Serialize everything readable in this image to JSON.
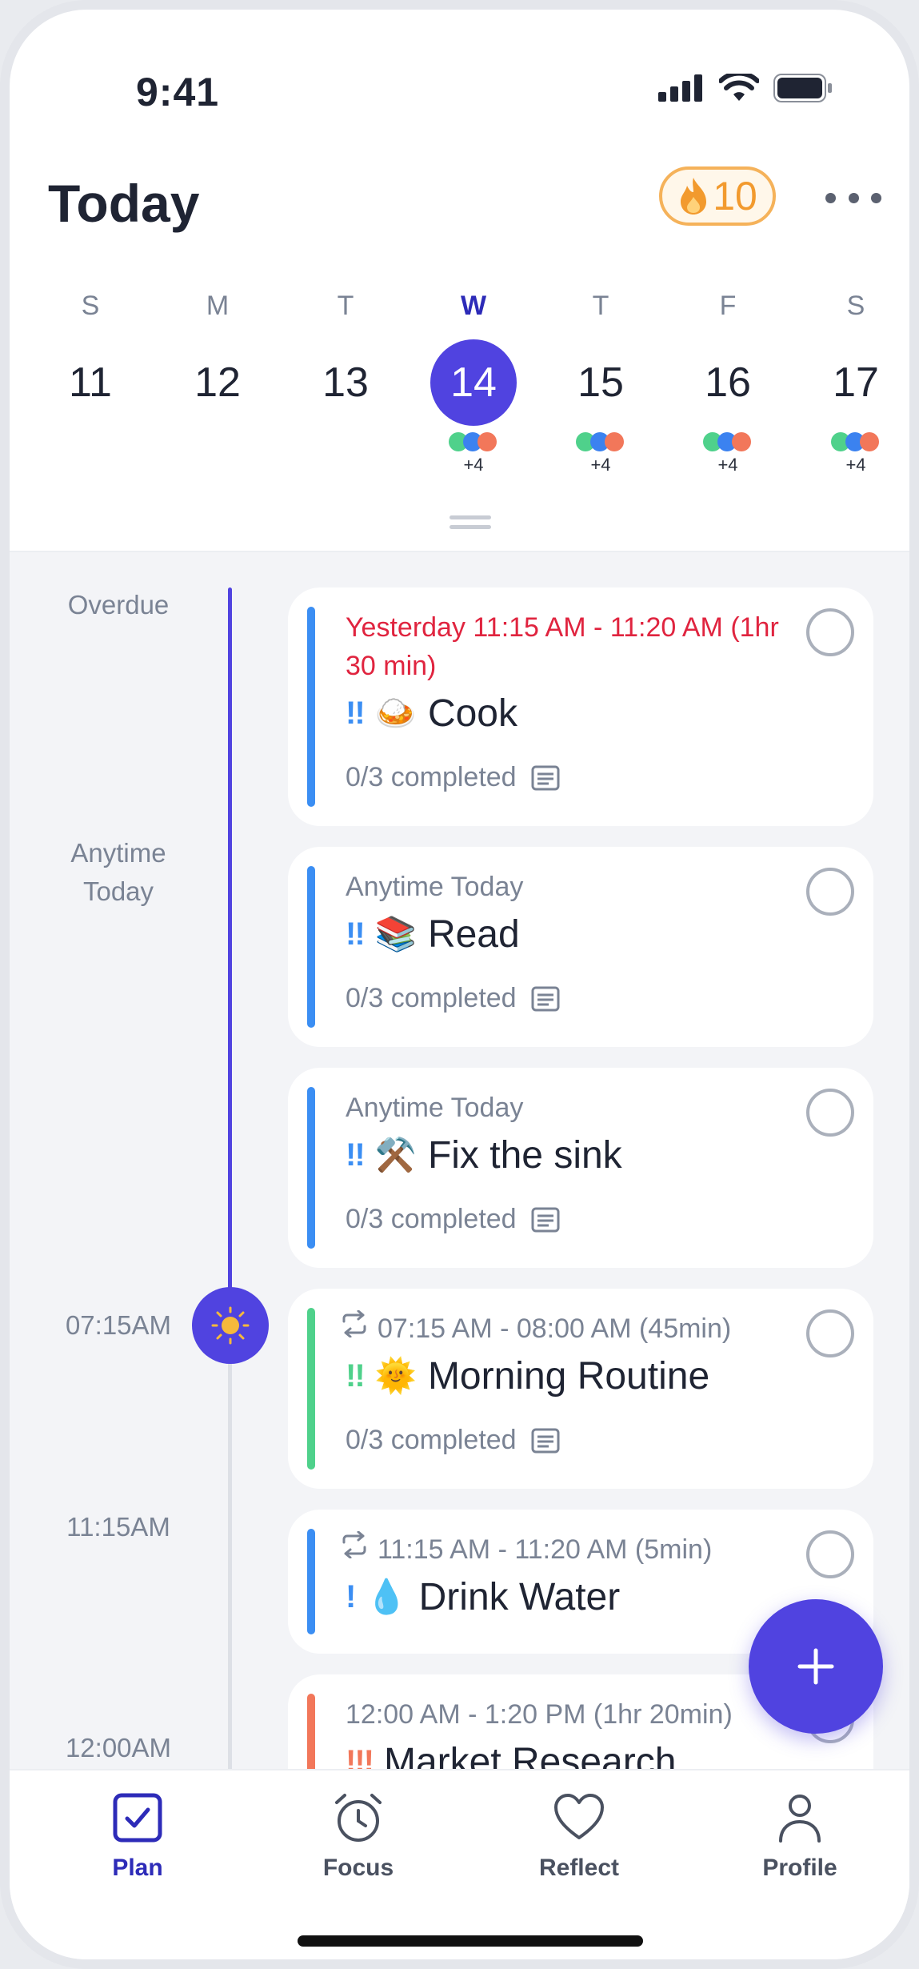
{
  "status_bar": {
    "time": "9:41"
  },
  "header": {
    "title": "Today",
    "streak_count": "10"
  },
  "week": {
    "days": [
      {
        "letter": "S",
        "number": "11",
        "dots": false,
        "more": ""
      },
      {
        "letter": "M",
        "number": "12",
        "dots": false,
        "more": ""
      },
      {
        "letter": "T",
        "number": "13",
        "dots": false,
        "more": ""
      },
      {
        "letter": "W",
        "number": "14",
        "dots": true,
        "more": "+4",
        "selected": true
      },
      {
        "letter": "T",
        "number": "15",
        "dots": true,
        "more": "+4"
      },
      {
        "letter": "F",
        "number": "16",
        "dots": true,
        "more": "+4"
      },
      {
        "letter": "S",
        "number": "17",
        "dots": true,
        "more": "+4"
      }
    ]
  },
  "timeline": {
    "labels": [
      "Overdue",
      "Anytime\nToday",
      "07:15AM",
      "11:15AM",
      "12:00AM"
    ]
  },
  "tasks": [
    {
      "meta": "Yesterday 11:15 AM - 11:20 AM (1hr 30 min)",
      "priority": "!!",
      "emoji": "🍛",
      "title": "Cook",
      "subtasks": "0/3 completed",
      "color": "#3b8ef3"
    },
    {
      "meta": "Anytime Today",
      "priority": "!!",
      "emoji": "📚",
      "title": "Read",
      "subtasks": "0/3 completed",
      "color": "#3b8ef3"
    },
    {
      "meta": "Anytime Today",
      "priority": "!!",
      "emoji": "⚒️",
      "title": "Fix the sink",
      "subtasks": "0/3 completed",
      "color": "#3b8ef3"
    },
    {
      "meta": "07:15 AM - 08:00 AM (45min)",
      "priority": "!!",
      "emoji": "🌞",
      "title": "Morning Routine",
      "subtasks": "0/3 completed",
      "color": "#4fd18b"
    },
    {
      "meta": "11:15 AM - 11:20 AM (5min)",
      "priority": "!",
      "emoji": "💧",
      "title": "Drink Water",
      "color": "#3b8ef3"
    },
    {
      "meta": "12:00 AM - 1:20 PM (1hr 20min)",
      "priority": "!!!",
      "emoji": "",
      "title": "Market Research",
      "color": "#f2775a"
    }
  ],
  "tabbar": {
    "tabs": [
      {
        "label": "Plan",
        "icon": "checkbox-icon",
        "active": true
      },
      {
        "label": "Focus",
        "icon": "alarm-clock-icon"
      },
      {
        "label": "Reflect",
        "icon": "heart-icon"
      },
      {
        "label": "Profile",
        "icon": "person-icon"
      }
    ]
  },
  "colors": {
    "accent": "#5043e0",
    "overdue": "#e0243f",
    "streak": "#f29a2e"
  }
}
